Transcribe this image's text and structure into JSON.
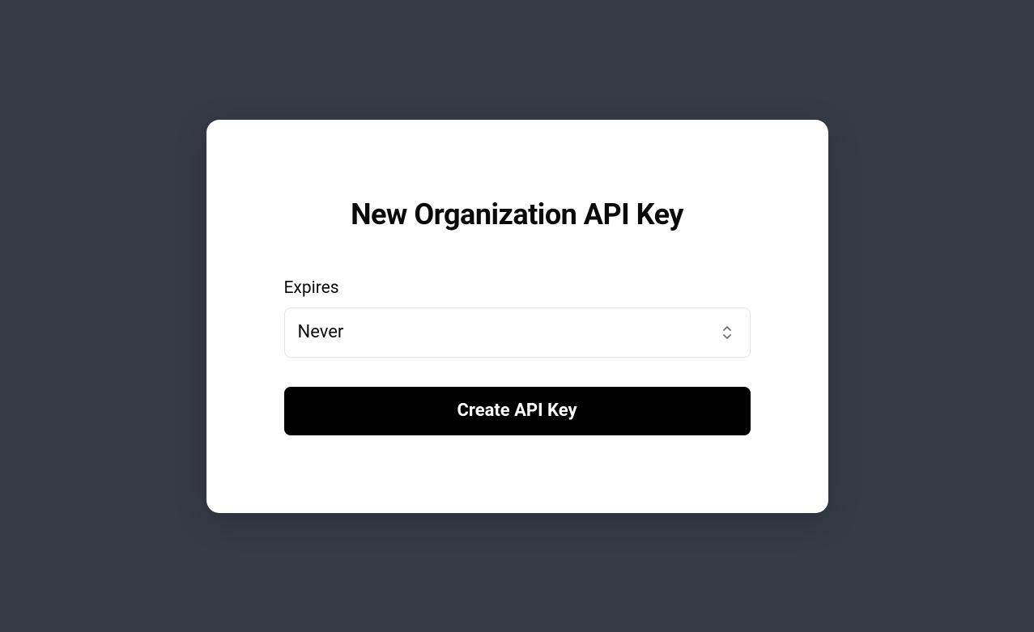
{
  "modal": {
    "title": "New Organization API Key",
    "expires": {
      "label": "Expires",
      "value": "Never"
    },
    "submit_label": "Create API Key"
  }
}
